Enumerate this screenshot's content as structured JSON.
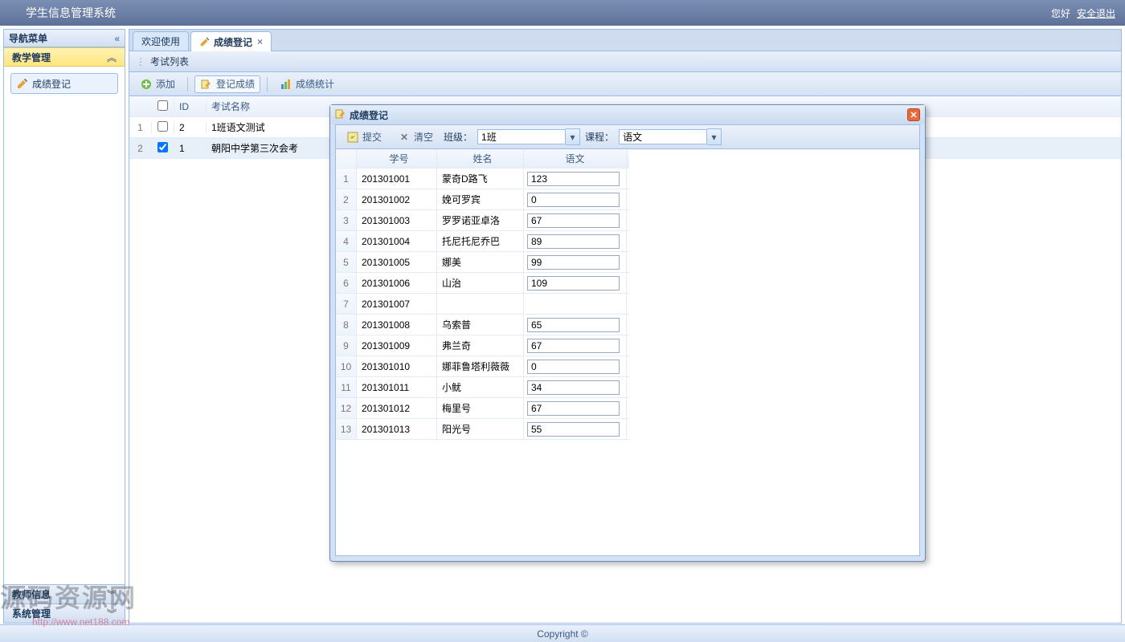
{
  "header": {
    "title": "学生信息管理系统",
    "greeting": "您好",
    "logout": "安全退出"
  },
  "sidebar": {
    "title": "导航菜单",
    "sections": [
      {
        "label": "教学管理",
        "active": true,
        "items": [
          {
            "label": "成绩登记"
          }
        ]
      },
      {
        "label": "教师信息",
        "active": false
      },
      {
        "label": "系统管理",
        "active": false
      }
    ]
  },
  "tabs": [
    {
      "label": "欢迎使用",
      "active": false,
      "closable": false
    },
    {
      "label": "成绩登记",
      "active": true,
      "closable": true
    }
  ],
  "panel": {
    "title": "考试列表",
    "toolbar": {
      "add": "添加",
      "register": "登记成绩",
      "stats": "成绩统计"
    },
    "columns": {
      "id": "ID",
      "name": "考试名称"
    },
    "rows": [
      {
        "rn": "1",
        "id": "2",
        "name": "1班语文测试",
        "checked": false
      },
      {
        "rn": "2",
        "id": "1",
        "name": "朝阳中学第三次会考",
        "checked": true
      }
    ]
  },
  "dialog": {
    "title": "成绩登记",
    "toolbar": {
      "submit": "提交",
      "clear": "清空",
      "class_label": "班级：",
      "class_value": "1班",
      "course_label": "课程：",
      "course_value": "语文"
    },
    "columns": {
      "sno": "学号",
      "name": "姓名",
      "score": "语文"
    },
    "rows": [
      {
        "rn": "1",
        "sno": "201301001",
        "name": "蒙奇D路飞",
        "score": "123"
      },
      {
        "rn": "2",
        "sno": "201301002",
        "name": "娩可罗宾",
        "score": "0"
      },
      {
        "rn": "3",
        "sno": "201301003",
        "name": "罗罗诺亚卓洛",
        "score": "67"
      },
      {
        "rn": "4",
        "sno": "201301004",
        "name": "托尼托尼乔巴",
        "score": "89"
      },
      {
        "rn": "5",
        "sno": "201301005",
        "name": "娜美",
        "score": "99"
      },
      {
        "rn": "6",
        "sno": "201301006",
        "name": "山治",
        "score": "109"
      },
      {
        "rn": "7",
        "sno": "201301007",
        "name": "",
        "score": ""
      },
      {
        "rn": "8",
        "sno": "201301008",
        "name": "乌索普",
        "score": "65"
      },
      {
        "rn": "9",
        "sno": "201301009",
        "name": "弗兰奇",
        "score": "67"
      },
      {
        "rn": "10",
        "sno": "201301010",
        "name": "娜菲鲁塔利薇薇",
        "score": "0"
      },
      {
        "rn": "11",
        "sno": "201301011",
        "name": "小鱿",
        "score": "34"
      },
      {
        "rn": "12",
        "sno": "201301012",
        "name": "梅里号",
        "score": "67"
      },
      {
        "rn": "13",
        "sno": "201301013",
        "name": "阳光号",
        "score": "55"
      }
    ]
  },
  "footer": {
    "text": "Copyright ©"
  },
  "watermark": {
    "text": "源码资源网",
    "url": "http://www.net188.com"
  }
}
